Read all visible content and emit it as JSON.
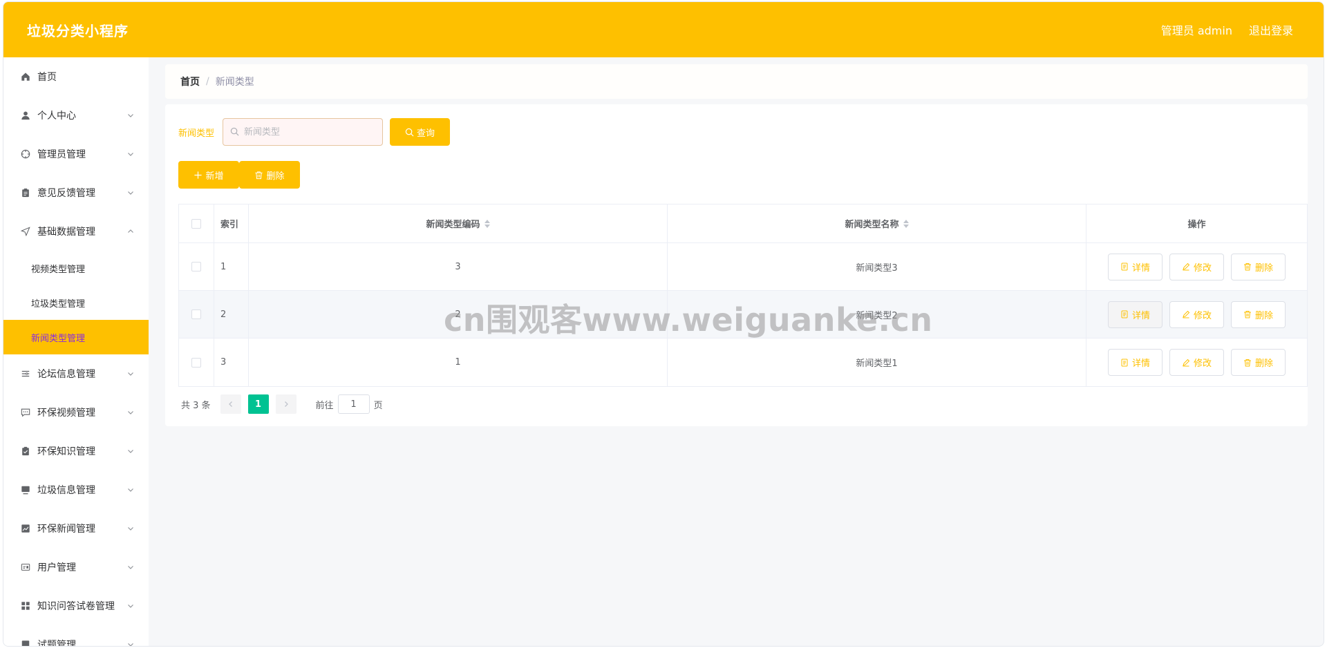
{
  "header": {
    "title": "垃圾分类小程序",
    "user_label": "管理员 admin",
    "logout_label": "退出登录"
  },
  "sidebar": {
    "items": [
      {
        "label": "首页",
        "icon": "home-icon",
        "has_arrow": false
      },
      {
        "label": "个人中心",
        "icon": "user-icon",
        "has_arrow": true
      },
      {
        "label": "管理员管理",
        "icon": "compass-icon",
        "has_arrow": true
      },
      {
        "label": "意见反馈管理",
        "icon": "clipboard-icon",
        "has_arrow": true
      },
      {
        "label": "基础数据管理",
        "icon": "navigation-icon",
        "has_arrow": true,
        "expanded": true
      },
      {
        "label": "论坛信息管理",
        "icon": "list-icon",
        "has_arrow": true
      },
      {
        "label": "环保视频管理",
        "icon": "chat-icon",
        "has_arrow": true
      },
      {
        "label": "环保知识管理",
        "icon": "checklist-icon",
        "has_arrow": true
      },
      {
        "label": "垃圾信息管理",
        "icon": "monitor-icon",
        "has_arrow": true
      },
      {
        "label": "环保新闻管理",
        "icon": "chart-icon",
        "has_arrow": true
      },
      {
        "label": "用户管理",
        "icon": "id-card-icon",
        "has_arrow": true
      },
      {
        "label": "知识问答试卷管理",
        "icon": "grid-icon",
        "has_arrow": true
      },
      {
        "label": "试题管理",
        "icon": "doc-icon",
        "has_arrow": true
      }
    ],
    "submenu": [
      {
        "label": "视频类型管理",
        "active": false
      },
      {
        "label": "垃圾类型管理",
        "active": false
      },
      {
        "label": "新闻类型管理",
        "active": true
      }
    ],
    "accent": "#fec000"
  },
  "breadcrumb": {
    "home": "首页",
    "separator": "/",
    "current": "新闻类型"
  },
  "search": {
    "label": "新闻类型",
    "placeholder": "新闻类型",
    "value": "",
    "button_label": "查询"
  },
  "actions": {
    "add_label": "新增",
    "delete_label": "删除"
  },
  "table": {
    "columns": [
      "索引",
      "新闻类型编码",
      "新闻类型名称",
      "操作"
    ],
    "rows": [
      {
        "index": "1",
        "code": "3",
        "name": "新闻类型3"
      },
      {
        "index": "2",
        "code": "2",
        "name": "新闻类型2"
      },
      {
        "index": "3",
        "code": "1",
        "name": "新闻类型1"
      }
    ],
    "row_actions": {
      "detail": "详情",
      "edit": "修改",
      "delete": "删除"
    }
  },
  "pagination": {
    "total_text": "共 3 条",
    "current_page": "1",
    "goto_prefix": "前往",
    "goto_value": "1",
    "goto_suffix": "页"
  },
  "watermark": "cn围观客www.weiguanke.cn",
  "colors": {
    "primary": "#fec000",
    "pager_active": "#00c292",
    "submenu_active_text": "#8a2be2"
  }
}
